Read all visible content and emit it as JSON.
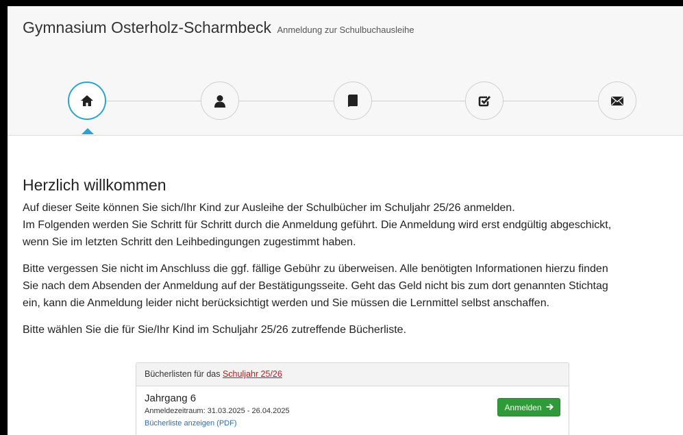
{
  "header": {
    "title": "Gymnasium Osterholz-Scharmbeck",
    "subtitle": "Anmeldung zur Schulbuchausleihe"
  },
  "steps": [
    {
      "icon": "home-icon",
      "active": true
    },
    {
      "icon": "user-icon",
      "active": false
    },
    {
      "icon": "book-icon",
      "active": false
    },
    {
      "icon": "checkbox-icon",
      "active": false
    },
    {
      "icon": "envelope-icon",
      "active": false
    }
  ],
  "colors": {
    "accent": "#2aa3cf",
    "button": "#2e9b38",
    "link": "#2a6fb0",
    "link_red": "#c0171d"
  },
  "welcome": {
    "title": "Herzlich willkommen",
    "paragraph1": [
      "Auf dieser Seite können Sie sich/Ihr Kind zur Ausleihe der Schulbücher im Schuljahr 25/26 anmelden.",
      "Im Folgenden werden Sie Schritt für Schritt durch die Anmeldung geführt. Die Anmeldung wird erst endgültig abgeschickt,",
      "wenn Sie im letzten Schritt den Leihbedingungen zugestimmt haben."
    ],
    "paragraph2": [
      "Bitte vergessen Sie nicht im Anschluss die ggf. fällige Gebühr zu überweisen. Alle benötigten Informationen hierzu finden",
      "Sie nach dem Absenden der Anmeldung auf der Bestätigungsseite. Geht das Geld nicht bis zum dort genannten Stichtag",
      "ein, kann die Anmeldung leider nicht berücksichtigt werden und Sie müssen die Lernmittel selbst anschaffen."
    ],
    "paragraph3": "Bitte wählen Sie die für Sie/Ihr Kind im Schuljahr 25/26 zutreffende Bücherliste."
  },
  "panel": {
    "heading_prefix": "Bücherlisten für das",
    "heading_link": "Schuljahr 25/26",
    "grade": "Jahrgang 6",
    "period": "Anmeldezeitraum: 31.03.2025 - 26.04.2025",
    "pdf_link": "Bücherliste anzeigen (PDF)",
    "button_label": "Anmelden"
  }
}
